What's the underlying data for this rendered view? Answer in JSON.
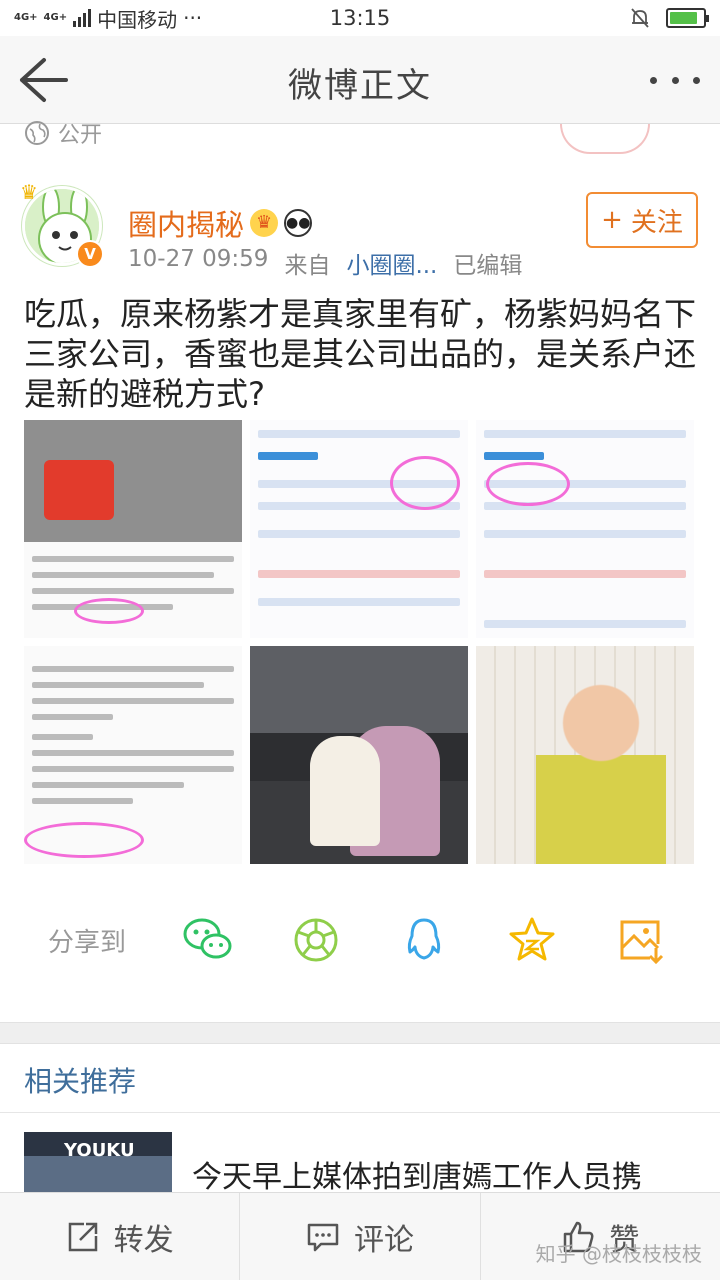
{
  "status_bar": {
    "network_1": "4G+",
    "network_2": "4G+",
    "carrier": "中国移动",
    "more": "···",
    "time": "13:15",
    "battery_level": 0.85,
    "colors": {
      "battery": "#54c048"
    }
  },
  "nav": {
    "title": "微博正文",
    "back_icon": "arrow-left-icon",
    "more_icon": "more-dots-icon"
  },
  "visibility": {
    "label": "公开",
    "icon": "globe-icon"
  },
  "author": {
    "name": "圈内揭秘",
    "crown_icon": "crown-icon",
    "badges": [
      "gold-crown-badge-icon",
      "panda-badge-icon"
    ],
    "verified_badge": "V",
    "date": "10-27 09:59",
    "from_label": "来自",
    "source": "小圈圈...",
    "edited": "已编辑",
    "follow": {
      "plus": "+",
      "label": "关注"
    },
    "colors": {
      "name": "#e46b1b",
      "follow_border": "#f28c33",
      "source": "#3d6fa8"
    }
  },
  "post": {
    "text": "吃瓜，原来杨紫才是真家里有矿，杨紫妈妈名下三家公司，香蜜也是其公司出品的，是关系户还是新的避税方式?"
  },
  "images": [
    {
      "kind": "screenshot-article"
    },
    {
      "kind": "screenshot-company-info"
    },
    {
      "kind": "screenshot-company-info"
    },
    {
      "kind": "screenshot-article"
    },
    {
      "kind": "photo-mother-child"
    },
    {
      "kind": "photo-portrait"
    }
  ],
  "share": {
    "label": "分享到",
    "targets": [
      {
        "icon": "wechat-icon",
        "color": "#2fc264"
      },
      {
        "icon": "moments-icon",
        "color": "#8fce4a"
      },
      {
        "icon": "qq-icon",
        "color": "#3aa6e8"
      },
      {
        "icon": "qzone-star-icon",
        "color": "#f5b800"
      },
      {
        "icon": "save-image-icon",
        "color": "#f5a623"
      }
    ]
  },
  "related": {
    "title": "相关推荐",
    "item": {
      "thumb_text": "YOUKU",
      "title": "今天早上媒体拍到唐嫣工作人员携"
    }
  },
  "bottom_bar": {
    "repost": {
      "icon": "repost-icon",
      "label": "转发"
    },
    "comment": {
      "icon": "comment-icon",
      "label": "评论"
    },
    "like": {
      "icon": "thumbs-up-icon",
      "label": "赞"
    }
  },
  "watermark": "知乎 @枝枝枝枝枝"
}
